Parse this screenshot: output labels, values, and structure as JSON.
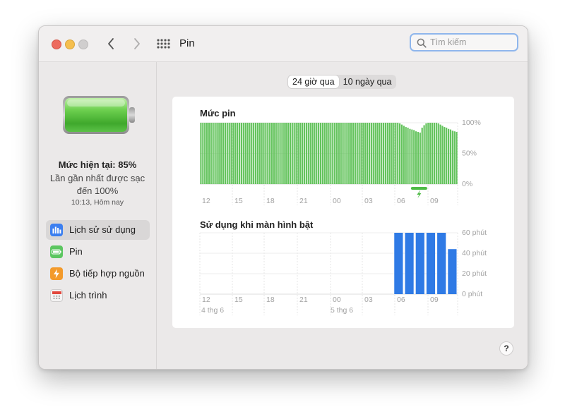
{
  "window": {
    "title": "Pin",
    "search": {
      "placeholder": "Tìm kiếm",
      "value": ""
    }
  },
  "sidebar": {
    "current_level": "Mức hiện tại: 85%",
    "last_charged": "Lần gần nhất được sạc đến 100%",
    "last_charged_time": "10:13, Hôm nay",
    "items": [
      {
        "label": "Lịch sử sử dụng",
        "icon": "bar-chart-icon",
        "color": "#3b7ff0",
        "active": true
      },
      {
        "label": "Pin",
        "icon": "battery-icon",
        "color": "#5cc660",
        "active": false
      },
      {
        "label": "Bộ tiếp hợp nguồn",
        "icon": "lightning-icon",
        "color": "#f39a2b",
        "active": false
      },
      {
        "label": "Lịch trình",
        "icon": "calendar-icon",
        "color": "#e8e6e6",
        "active": false
      }
    ]
  },
  "tabs": [
    {
      "label": "24 giờ qua",
      "active": true
    },
    {
      "label": "10 ngày qua",
      "active": false
    }
  ],
  "help_label": "?",
  "colors": {
    "battery_green": "#63c35c",
    "usage_blue": "#2f7ae5",
    "accent_focus": "#8fb6ec"
  },
  "chart_data": [
    {
      "type": "bar",
      "title": "Mức pin",
      "y_ticks": [
        "100%",
        "50%",
        "0%"
      ],
      "ylim": [
        0,
        100
      ],
      "x_ticks": [
        "12",
        "15",
        "18",
        "21",
        "00",
        "03",
        "06",
        "09"
      ],
      "values": [
        100,
        100,
        100,
        100,
        100,
        100,
        100,
        100,
        100,
        100,
        100,
        100,
        100,
        100,
        100,
        100,
        100,
        100,
        100,
        100,
        100,
        100,
        100,
        100,
        100,
        100,
        100,
        100,
        100,
        100,
        100,
        100,
        100,
        100,
        100,
        100,
        100,
        100,
        100,
        100,
        100,
        100,
        100,
        100,
        100,
        100,
        100,
        100,
        100,
        100,
        100,
        100,
        100,
        100,
        100,
        100,
        100,
        100,
        100,
        100,
        100,
        100,
        100,
        100,
        100,
        100,
        100,
        100,
        100,
        100,
        100,
        100,
        100,
        100,
        100,
        100,
        100,
        100,
        100,
        100,
        100,
        100,
        100,
        100,
        100,
        100,
        100,
        100,
        100,
        100,
        100,
        100,
        100,
        100,
        100,
        100,
        100,
        100,
        99,
        97,
        95,
        93,
        92,
        90,
        89,
        88,
        86,
        85,
        84,
        92,
        96,
        99,
        100,
        100,
        100,
        100,
        100,
        99,
        97,
        95,
        93,
        92,
        90,
        89,
        87,
        86,
        85
      ],
      "charging_interval_slots": [
        104,
        112
      ]
    },
    {
      "type": "bar",
      "title": "Sử dụng khi màn hình bật",
      "y_ticks": [
        "60 phút",
        "40 phút",
        "20 phút",
        "0 phút"
      ],
      "ylim": [
        0,
        60
      ],
      "x_ticks": [
        "12",
        "15",
        "18",
        "21",
        "00",
        "03",
        "06",
        "09"
      ],
      "date_labels": [
        "4 thg 6",
        "5 thg 6"
      ],
      "values": [
        0,
        0,
        0,
        0,
        0,
        0,
        0,
        0,
        0,
        0,
        0,
        0,
        0,
        0,
        0,
        0,
        0,
        0,
        60,
        60,
        60,
        60,
        60,
        44
      ]
    }
  ]
}
